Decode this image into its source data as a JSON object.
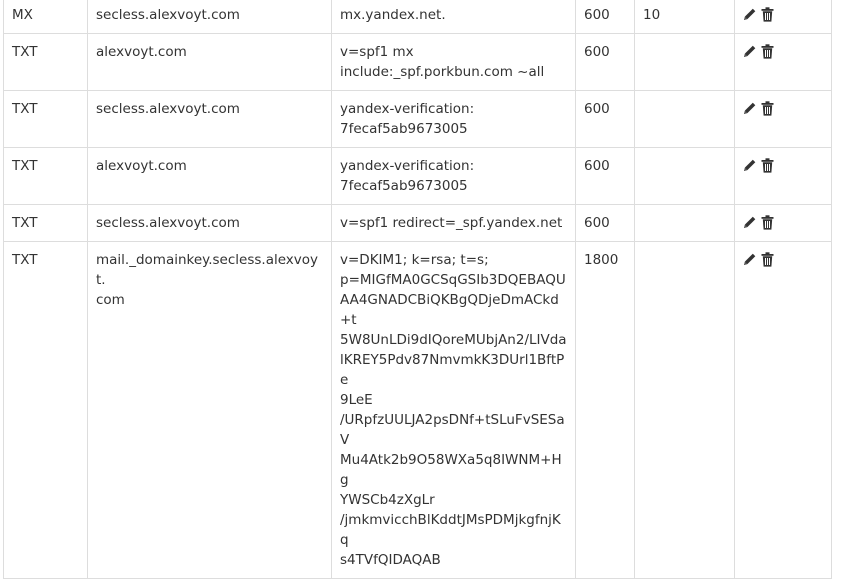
{
  "records": [
    {
      "type": "MX",
      "host_lines": [
        "secless.alexvoyt.com"
      ],
      "answer_lines": [
        "mx.yandex.net."
      ],
      "ttl": "600",
      "priority": "10"
    },
    {
      "type": "TXT",
      "host_lines": [
        "alexvoyt.com"
      ],
      "answer_lines": [
        "v=spf1 mx",
        "include:_spf.porkbun.com ~all"
      ],
      "ttl": "600",
      "priority": ""
    },
    {
      "type": "TXT",
      "host_lines": [
        "secless.alexvoyt.com"
      ],
      "answer_lines": [
        "yandex-verification:",
        "7fecaf5ab9673005"
      ],
      "ttl": "600",
      "priority": ""
    },
    {
      "type": "TXT",
      "host_lines": [
        "alexvoyt.com"
      ],
      "answer_lines": [
        "yandex-verification:",
        "7fecaf5ab9673005"
      ],
      "ttl": "600",
      "priority": ""
    },
    {
      "type": "TXT",
      "host_lines": [
        "secless.alexvoyt.com"
      ],
      "answer_lines": [
        "v=spf1 redirect=_spf.yandex.net"
      ],
      "ttl": "600",
      "priority": ""
    },
    {
      "type": "TXT",
      "host_lines": [
        "mail._domainkey.secless.alexvoyt.",
        "com"
      ],
      "answer_lines": [
        "v=DKIM1; k=rsa; t=s;",
        "p=MIGfMA0GCSqGSIb3DQEBAQU",
        "AA4GNADCBiQKBgQDjeDmACkd+t",
        "5W8UnLDi9dIQoreMUbjAn2/LIVda",
        "lKREY5Pdv87NmvmkK3DUrl1BftPe",
        "9LeE",
        "/URpfzUULJA2psDNf+tSLuFvSESaV",
        "Mu4Atk2b9O58WXa5q8IWNM+Hg",
        "YWSCb4zXgLr",
        "/jmkmvicchBlKddtJMsPDMjkgfnjKq",
        "s4TVfQIDAQAB"
      ],
      "ttl": "1800",
      "priority": ""
    }
  ],
  "icons": {
    "edit": "pencil-icon",
    "delete": "trash-icon",
    "icon_color": "#333333"
  }
}
